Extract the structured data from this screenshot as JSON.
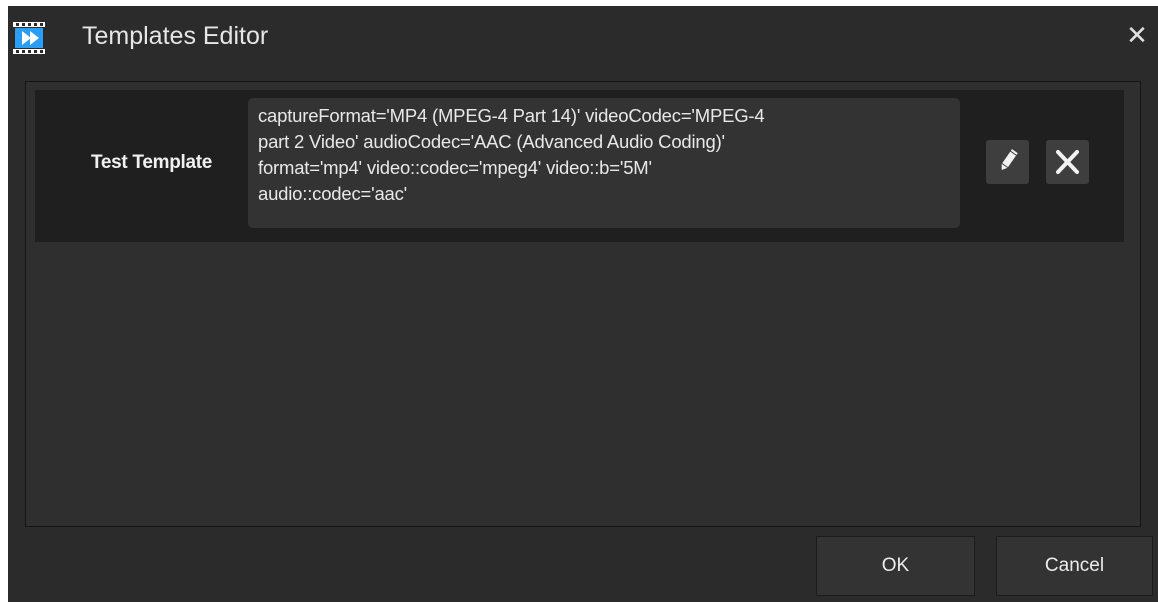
{
  "window": {
    "title": "Templates Editor",
    "close_glyph": "✕",
    "app_icon": "video-editor-icon"
  },
  "templates": [
    {
      "name": "Test Template",
      "value": "captureFormat='MP4 (MPEG-4 Part 14)' videoCodec='MPEG-4\npart 2 Video' audioCodec='AAC (Advanced Audio Coding)'\nformat='mp4' video::codec='mpeg4' video::b='5M'\naudio::codec='aac'",
      "edit_icon": "pencil-icon",
      "delete_icon": "close-icon"
    }
  ],
  "footer": {
    "ok_label": "OK",
    "cancel_label": "Cancel"
  },
  "colors": {
    "background": "#2b2b2b",
    "row_background": "#1f1f1f",
    "icon_accent": "#2a9df4"
  }
}
